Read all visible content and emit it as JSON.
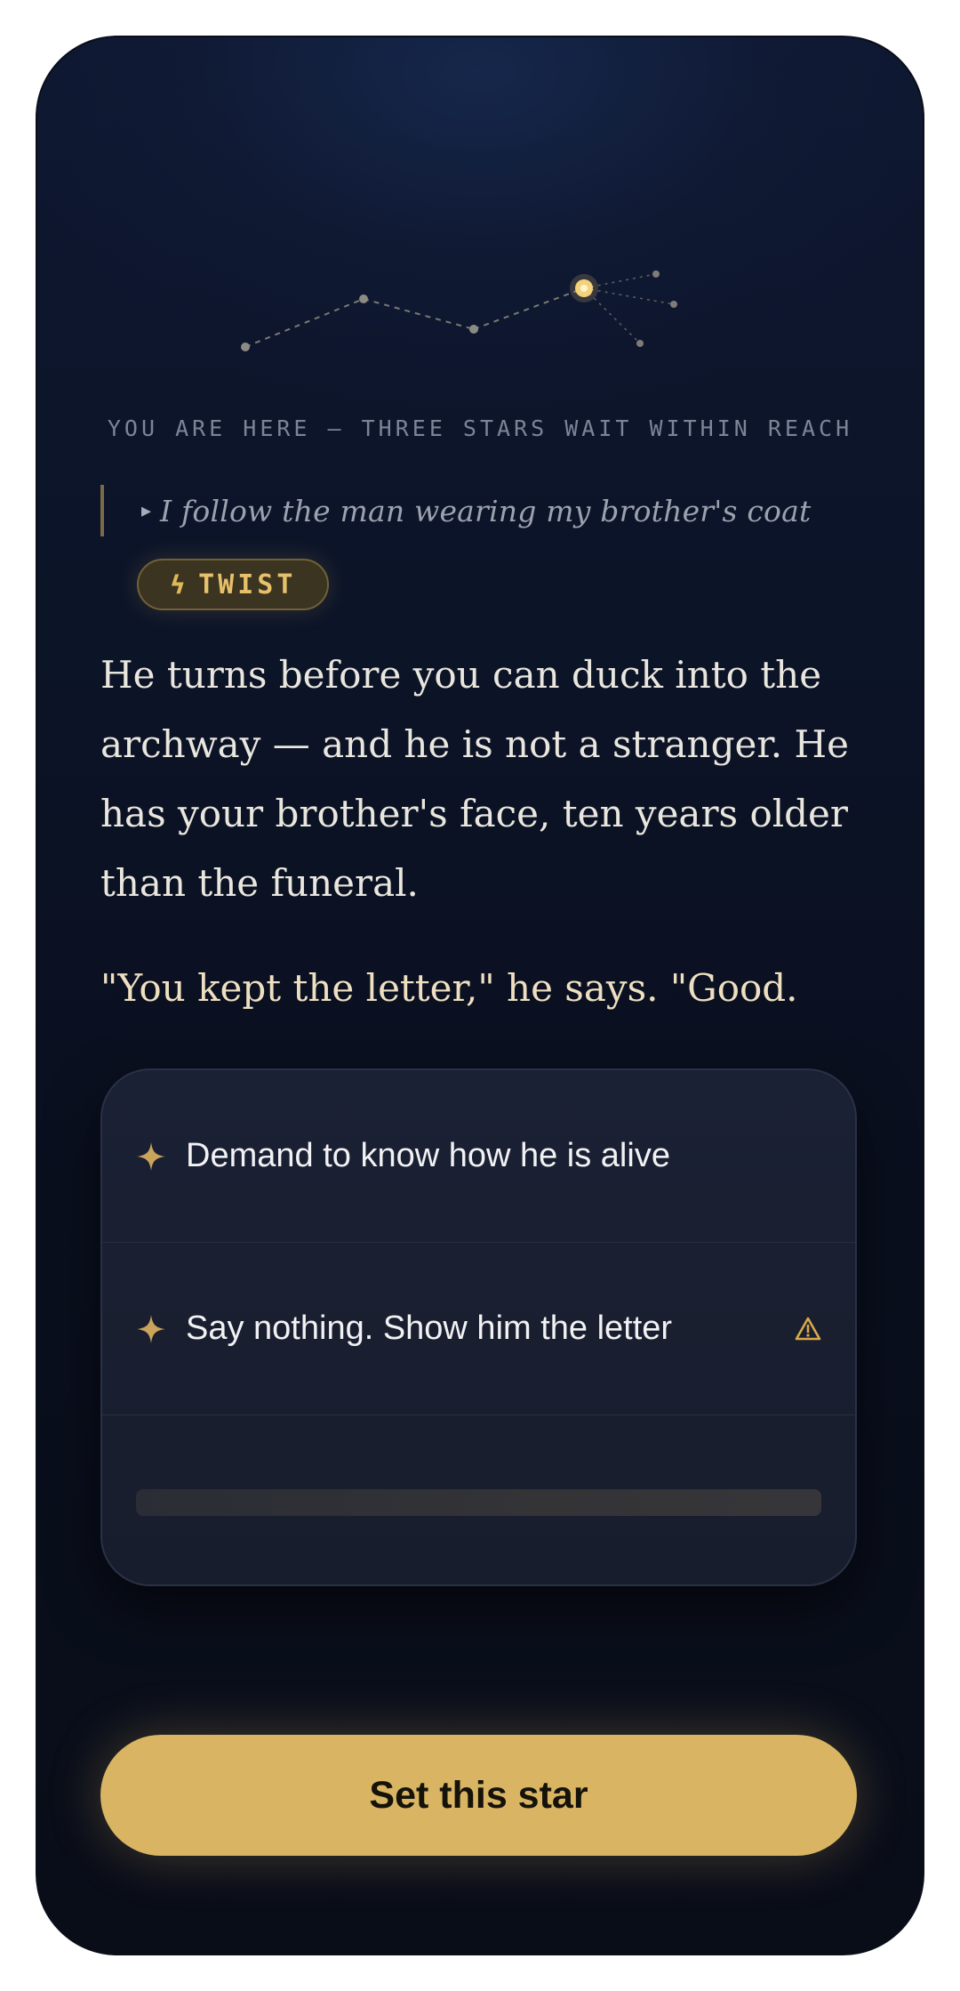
{
  "progress": {
    "status_text": "YOU ARE HERE — THREE STARS WAIT WITHIN REACH",
    "current_star_color": "#f3d27a"
  },
  "previous_choice": {
    "caret_icon": "caret-right-icon",
    "text": "I follow the man wearing my brother's coat"
  },
  "badge": {
    "icon": "bolt-icon",
    "icon_glyph": "ϟ",
    "label": "TWIST"
  },
  "story": {
    "paragraph": "He turns before you can duck into the archway — and he is not a stranger. He has your brother's face, ten years older than the funeral.",
    "quote": "\"You kept the letter,\" he says. \"Good."
  },
  "choices": [
    {
      "icon": "sparkle-star-icon",
      "text": "Demand to know how he is alive",
      "warning": false
    },
    {
      "icon": "sparkle-star-icon",
      "text": "Say nothing. Show him the letter",
      "warning": true,
      "warning_icon": "warning-triangle-icon"
    },
    {
      "icon": "",
      "text": "",
      "loading": true
    }
  ],
  "cta": {
    "label": "Set this star"
  },
  "colors": {
    "accent": "#d9b563",
    "background": "#0b1122",
    "card": "#1a1f30"
  }
}
